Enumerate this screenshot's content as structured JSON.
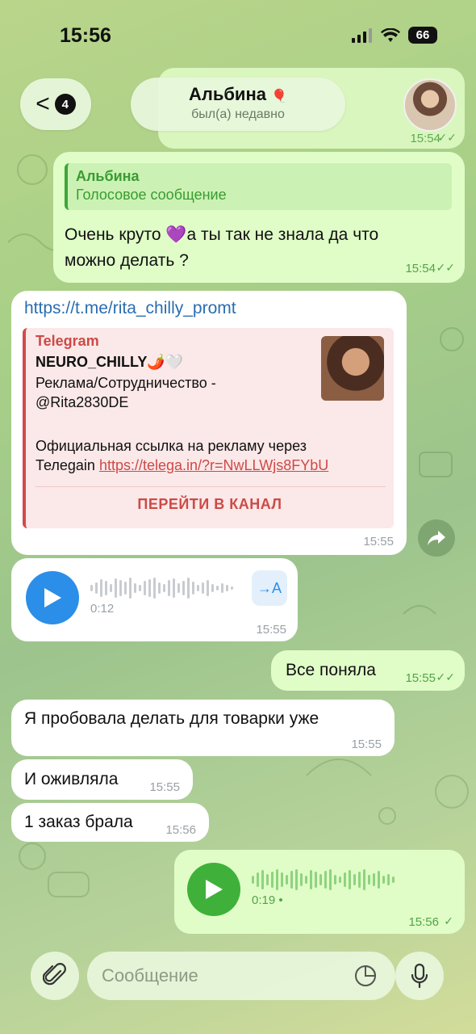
{
  "status_bar": {
    "time": "15:56",
    "battery": "66"
  },
  "header": {
    "back_badge": "4",
    "chat_name": "Альбина",
    "chat_status": "был(а) недавно"
  },
  "top_partial": {
    "time": "15:54"
  },
  "messages": [
    {
      "type": "text_reply",
      "reply_author": "Альбина",
      "reply_text": "Голосовое сообщение",
      "line1": "Очень круто 💜а ты так не знала да что",
      "line2": "можно делать ?",
      "time": "15:54"
    },
    {
      "type": "link",
      "url": "https://t.me/rita_chilly_promt",
      "site": "Telegram",
      "title": "NEURO_CHILLY🌶️🤍",
      "line1": "Реклама/Сотрудничество  -",
      "line2": "@Rita2830DE",
      "line3": "Официальная ссылка на рекламу через",
      "line4_prefix": "Телеgain ",
      "line4_link": "https://telega.in/?r=NwLLWjs8FYbU",
      "button": "ПЕРЕЙТИ В КАНАЛ",
      "time": "15:55"
    },
    {
      "type": "voice_in",
      "duration": "0:12",
      "time": "15:55",
      "transcribe_label": "→A"
    },
    {
      "type": "text_out",
      "text": "Все поняла",
      "time": "15:55"
    },
    {
      "type": "text_in",
      "text": "Я пробовала делать для товарки уже",
      "time": "15:55"
    },
    {
      "type": "text_in",
      "text": "И оживляла",
      "time": "15:55"
    },
    {
      "type": "text_in",
      "text": "1 заказ брала",
      "time": "15:56"
    },
    {
      "type": "voice_out",
      "duration": "0:19",
      "time": "15:56"
    }
  ],
  "input": {
    "placeholder": "Сообщение"
  },
  "colors": {
    "accent_out": "#3fb13a",
    "accent_in": "#2b8ee8",
    "link_red": "#cc4a47"
  }
}
